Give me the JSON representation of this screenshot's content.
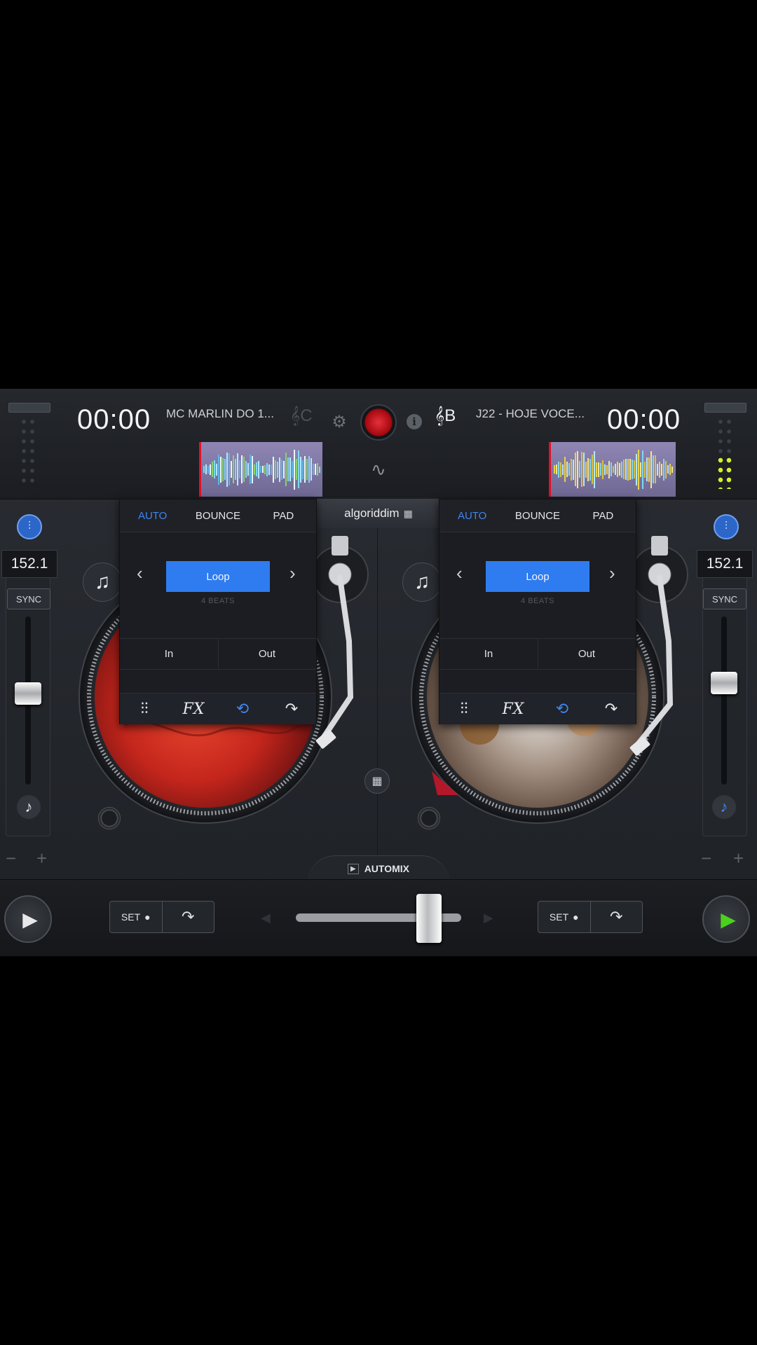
{
  "deckA": {
    "time": "00:00",
    "track": "MC MARLIN DO 1...",
    "key": "C",
    "bpm": "152.1",
    "sync": "SYNC",
    "minus": "−",
    "plus": "+",
    "tabs": [
      "AUTO",
      "BOUNCE",
      "PAD"
    ],
    "active_tab": "AUTO",
    "loop_label": "Loop",
    "beats": "4 BEATS",
    "in_label": "In",
    "out_label": "Out",
    "set_label": "SET",
    "pitch_level": 0.45
  },
  "deckB": {
    "time": "00:00",
    "track": "J22 - HOJE VOCE...",
    "key": "B",
    "bpm": "152.1",
    "sync": "SYNC",
    "minus": "−",
    "plus": "+",
    "tabs": [
      "AUTO",
      "BOUNCE",
      "PAD"
    ],
    "active_tab": "AUTO",
    "loop_label": "Loop",
    "beats": "4 BEATS",
    "in_label": "In",
    "out_label": "Out",
    "set_label": "SET",
    "pitch_level": 0.38
  },
  "center": {
    "logo_text": "algoriddim",
    "automix_label": "AUTOMIX",
    "crossfader_level": 0.86
  },
  "colors": {
    "accent_blue": "#2f7cf0",
    "play_green": "#4cd11e",
    "record_red": "#c0101a",
    "level_meter": "#d7ef2a"
  },
  "icons": {
    "settings": "gear-icon",
    "record": "record-icon",
    "info": "info-icon",
    "waveform": "waveform-icon",
    "eq": "eq-sliders-icon",
    "fx": "fx-icon",
    "loop": "loop-icon",
    "skip": "skip-icon",
    "add_track": "add-track-icon",
    "grid": "grid-icon"
  }
}
